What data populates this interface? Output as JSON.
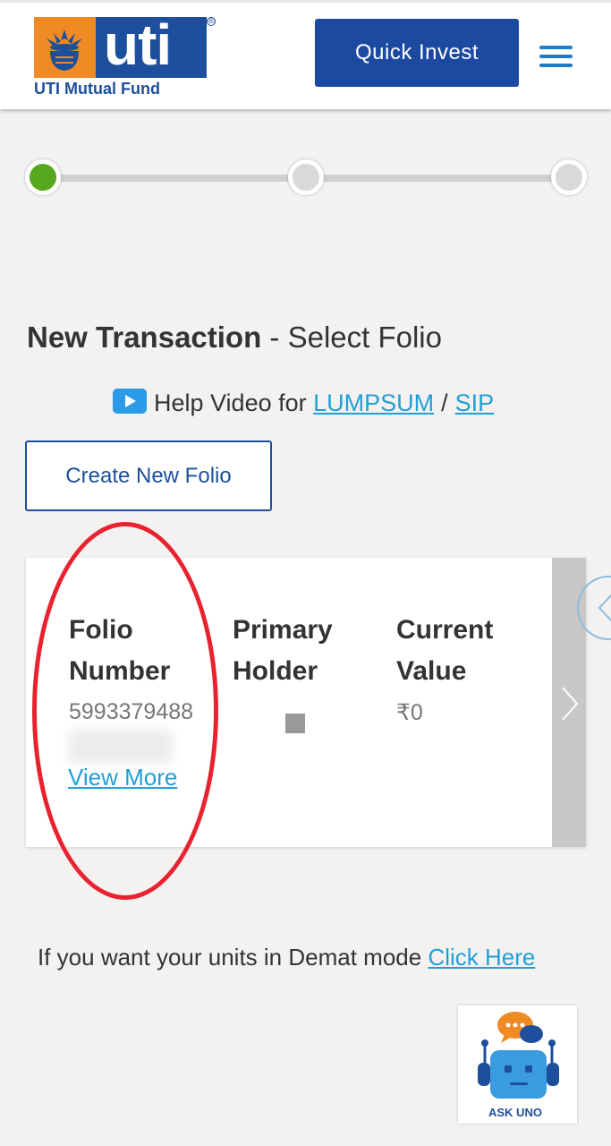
{
  "header": {
    "logo_text": "uti",
    "logo_subtitle": "UTI Mutual Fund",
    "logo_reg": "®",
    "quick_invest_label": "Quick Invest"
  },
  "stepper": {
    "steps": [
      "step-1",
      "step-2",
      "step-3"
    ],
    "active_step": 1
  },
  "page": {
    "title_strong": "New Transaction",
    "title_rest": " - Select Folio",
    "help_prefix": "Help Video for",
    "help_link_lumpsum": "LUMPSUM",
    "help_sep": "/",
    "help_link_sip": "SIP",
    "create_folio_label": "Create New Folio"
  },
  "folio_card": {
    "col1_head_line1": "Folio",
    "col1_head_line2": "Number",
    "col1_value": "5993379488",
    "col2_head_line1": "Primary",
    "col2_head_line2": "Holder",
    "col3_head_line1": "Current",
    "col3_head_line2": "Value",
    "col3_value": "₹0",
    "view_more_label": "View More"
  },
  "demat": {
    "text": "If you want your units in Demat mode ",
    "link": "Click Here"
  },
  "chatbot": {
    "label": "ASK UNO"
  },
  "colors": {
    "brand_blue": "#1d4f9c",
    "brand_orange": "#f08a24",
    "link_blue": "#1fa0d6",
    "active_step": "#56a81f",
    "annotation_red": "#e8232f"
  }
}
